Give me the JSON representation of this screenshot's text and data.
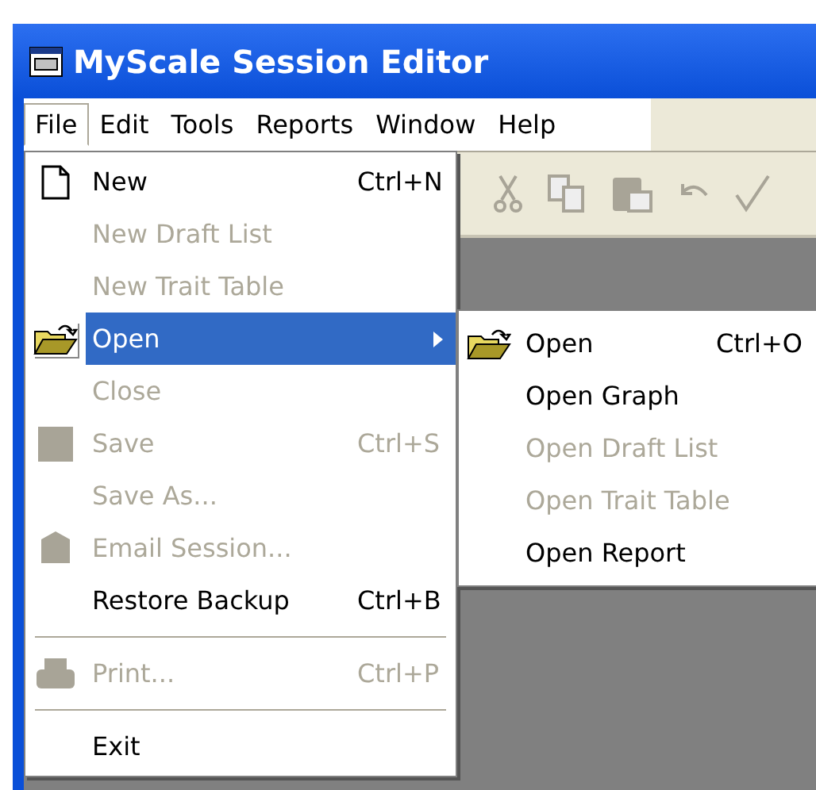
{
  "window": {
    "title": "MyScale Session Editor"
  },
  "menubar": [
    {
      "label": "File",
      "selected": true
    },
    {
      "label": "Edit",
      "selected": false
    },
    {
      "label": "Tools",
      "selected": false
    },
    {
      "label": "Reports",
      "selected": false
    },
    {
      "label": "Window",
      "selected": false
    },
    {
      "label": "Help",
      "selected": false
    }
  ],
  "file_menu": [
    {
      "kind": "item",
      "label": "New",
      "shortcut": "Ctrl+N",
      "disabled": false,
      "selected": false
    },
    {
      "kind": "item",
      "label": "New Draft List",
      "disabled": true,
      "selected": false
    },
    {
      "kind": "item",
      "label": "New Trait Table",
      "disabled": true,
      "selected": false
    },
    {
      "kind": "submenu",
      "label": "Open",
      "disabled": false,
      "selected": true
    },
    {
      "kind": "item",
      "label": "Close",
      "disabled": true,
      "selected": false
    },
    {
      "kind": "item",
      "label": "Save",
      "shortcut": "Ctrl+S",
      "disabled": true,
      "selected": false
    },
    {
      "kind": "item",
      "label": "Save As...",
      "disabled": true,
      "selected": false
    },
    {
      "kind": "item",
      "label": "Email Session...",
      "disabled": true,
      "selected": false
    },
    {
      "kind": "item",
      "label": "Restore Backup",
      "shortcut": "Ctrl+B",
      "disabled": false,
      "selected": false
    },
    {
      "kind": "separator"
    },
    {
      "kind": "item",
      "label": "Print...",
      "shortcut": "Ctrl+P",
      "disabled": true,
      "selected": false
    },
    {
      "kind": "separator"
    },
    {
      "kind": "item",
      "label": "Exit",
      "disabled": false,
      "selected": false
    }
  ],
  "open_submenu": [
    {
      "label": "Open",
      "shortcut": "Ctrl+O",
      "disabled": false
    },
    {
      "label": "Open Graph",
      "disabled": false
    },
    {
      "label": "Open Draft List",
      "disabled": true
    },
    {
      "label": "Open Trait Table",
      "disabled": true
    },
    {
      "label": "Open Report",
      "disabled": false
    }
  ]
}
